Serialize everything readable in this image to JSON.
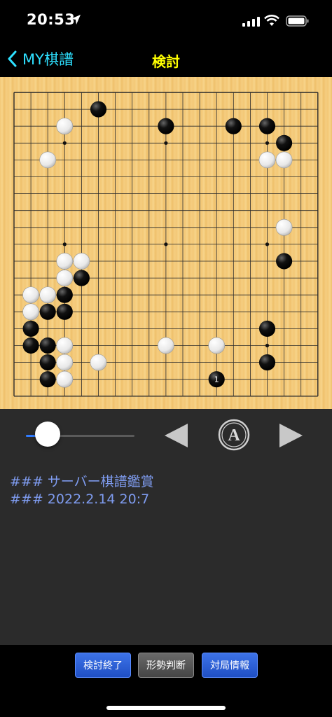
{
  "status_bar": {
    "time": "20:53"
  },
  "nav": {
    "back_label": "MY棋譜",
    "title": "検討"
  },
  "board": {
    "size": 19,
    "black_stones": [
      [
        5,
        1
      ],
      [
        9,
        2
      ],
      [
        13,
        2
      ],
      [
        15,
        2
      ],
      [
        16,
        3
      ],
      [
        16,
        10
      ],
      [
        4,
        11
      ],
      [
        3,
        12
      ],
      [
        2,
        13
      ],
      [
        3,
        13
      ],
      [
        1,
        14
      ],
      [
        15,
        14
      ],
      [
        1,
        15
      ],
      [
        2,
        15
      ],
      [
        2,
        16
      ],
      [
        15,
        16
      ],
      [
        2,
        17
      ]
    ],
    "white_stones": [
      [
        3,
        2
      ],
      [
        2,
        4
      ],
      [
        15,
        4
      ],
      [
        16,
        4
      ],
      [
        16,
        8
      ],
      [
        3,
        10
      ],
      [
        4,
        10
      ],
      [
        3,
        11
      ],
      [
        1,
        12
      ],
      [
        2,
        12
      ],
      [
        1,
        13
      ],
      [
        3,
        15
      ],
      [
        9,
        15
      ],
      [
        12,
        15
      ],
      [
        3,
        16
      ],
      [
        5,
        16
      ],
      [
        3,
        17
      ]
    ],
    "last_move": {
      "point": [
        12,
        17
      ],
      "label": "1"
    }
  },
  "controls": {
    "slider_value": 0,
    "prev_icon": "play-left-icon",
    "auto_icon": "auto-play-icon",
    "auto_letter": "A",
    "next_icon": "play-right-icon"
  },
  "comment": {
    "line1": "### サーバー棋譜鑑賞",
    "line2": "### 2022.2.14 20:7"
  },
  "buttons": {
    "end_review": "検討終了",
    "position_judgment": "形勢判断",
    "game_info": "対局情報"
  }
}
